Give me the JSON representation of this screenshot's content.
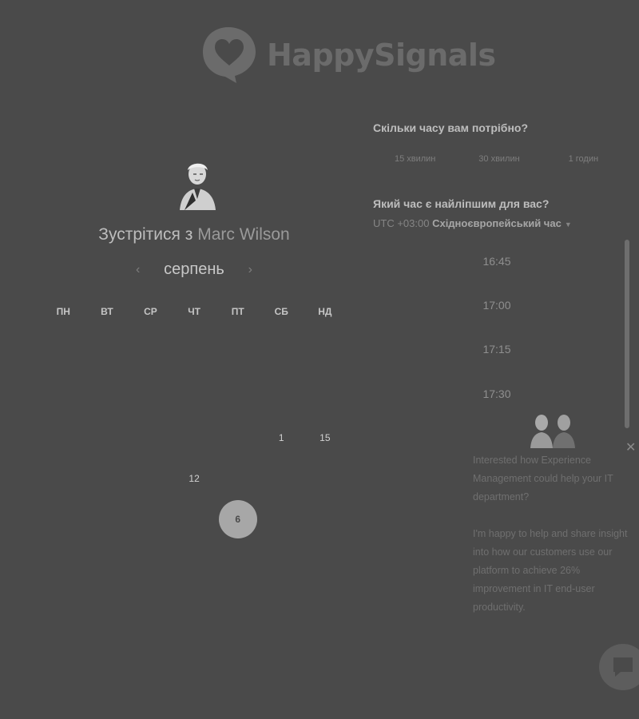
{
  "brand": {
    "name": "HappySignals",
    "icon": "heart-speech-bubble-icon"
  },
  "calendar": {
    "meet_prefix": "Зустрітися з",
    "host_name": "Marc Wilson",
    "month": "серпень",
    "weekdays": [
      "ПН",
      "ВТ",
      "СР",
      "ЧТ",
      "ПТ",
      "СБ",
      "НД"
    ],
    "weeks": [
      [
        {
          "d": "",
          "s": ""
        },
        {
          "d": "",
          "s": ""
        },
        {
          "d": "",
          "s": ""
        },
        {
          "d": "",
          "s": ""
        },
        {
          "d": "",
          "s": ""
        },
        {
          "d": "",
          "s": ""
        },
        {
          "d": "",
          "s": ""
        }
      ],
      [
        {
          "d": "",
          "s": ""
        },
        {
          "d": "",
          "s": ""
        },
        {
          "d": "",
          "s": ""
        },
        {
          "d": "",
          "s": ""
        },
        {
          "d": "",
          "s": ""
        },
        {
          "d": "",
          "s": ""
        },
        {
          "d": "",
          "s": ""
        }
      ],
      [
        {
          "d": "",
          "s": ""
        },
        {
          "d": "",
          "s": ""
        },
        {
          "d": "",
          "s": ""
        },
        {
          "d": "",
          "s": ""
        },
        {
          "d": "",
          "s": ""
        },
        {
          "d": "1",
          "s": "available"
        },
        {
          "d": "15",
          "s": "available"
        }
      ],
      [
        {
          "d": "",
          "s": ""
        },
        {
          "d": "",
          "s": ""
        },
        {
          "d": "",
          "s": ""
        },
        {
          "d": "12",
          "s": "available"
        },
        {
          "d": "",
          "s": ""
        },
        {
          "d": "",
          "s": ""
        },
        {
          "d": "",
          "s": ""
        }
      ],
      [
        {
          "d": "",
          "s": ""
        },
        {
          "d": "",
          "s": ""
        },
        {
          "d": "",
          "s": ""
        },
        {
          "d": "",
          "s": ""
        },
        {
          "d": "6",
          "s": "selected"
        },
        {
          "d": "",
          "s": ""
        },
        {
          "d": "",
          "s": ""
        }
      ],
      [
        {
          "d": "",
          "s": ""
        },
        {
          "d": "",
          "s": ""
        },
        {
          "d": "",
          "s": ""
        },
        {
          "d": "",
          "s": ""
        },
        {
          "d": "",
          "s": ""
        },
        {
          "d": "",
          "s": ""
        },
        {
          "d": "",
          "s": ""
        }
      ]
    ]
  },
  "booking": {
    "duration_question": "Скільки часу вам потрібно?",
    "durations": [
      "15 хвилин",
      "30 хвилин",
      "1 годин"
    ],
    "time_question": "Який час є найліпшим для вас?",
    "timezone_offset": "UTC +03:00",
    "timezone_name": "Східноєвропейський час",
    "times": [
      "16:45",
      "17:00",
      "17:15",
      "17:30"
    ]
  },
  "chat": {
    "message_1": "Interested how Experience Management could help your IT department?",
    "message_2": "I'm happy to help and share insight into how our customers use our platform to achieve 26% improvement in IT end-user productivity."
  }
}
